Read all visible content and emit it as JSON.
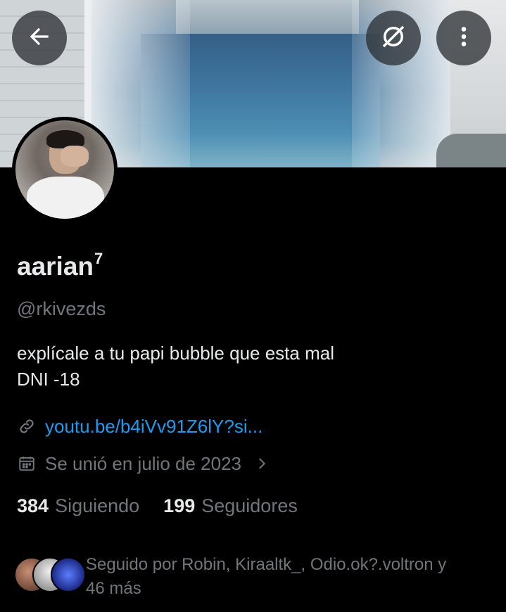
{
  "profile": {
    "name": "aarian",
    "name_sup": "7",
    "handle": "@rkivezds",
    "bio_line1": "explícale a tu papi bubble que esta mal",
    "bio_line2": "DNI -18",
    "link": "youtu.be/b4iVv91Z6lY?si...",
    "joined": "Se unió en julio de 2023"
  },
  "stats": {
    "following_count": "384",
    "following_label": "Siguiendo",
    "followers_count": "199",
    "followers_label": "Seguidores"
  },
  "followed_by": {
    "line1": "Seguido por Robin, Kiraaltk_, Odio.ok?.voltron y",
    "line2": "46 más"
  },
  "icons": {
    "back": "arrow-left-icon",
    "grok": "grok-icon",
    "more": "more-vertical-icon",
    "link": "link-icon",
    "calendar": "calendar-icon",
    "chevron": "chevron-right-icon"
  },
  "colors": {
    "background": "#000000",
    "text_primary": "#e7e9ea",
    "text_secondary": "#71767b",
    "link": "#1d9bf0"
  }
}
